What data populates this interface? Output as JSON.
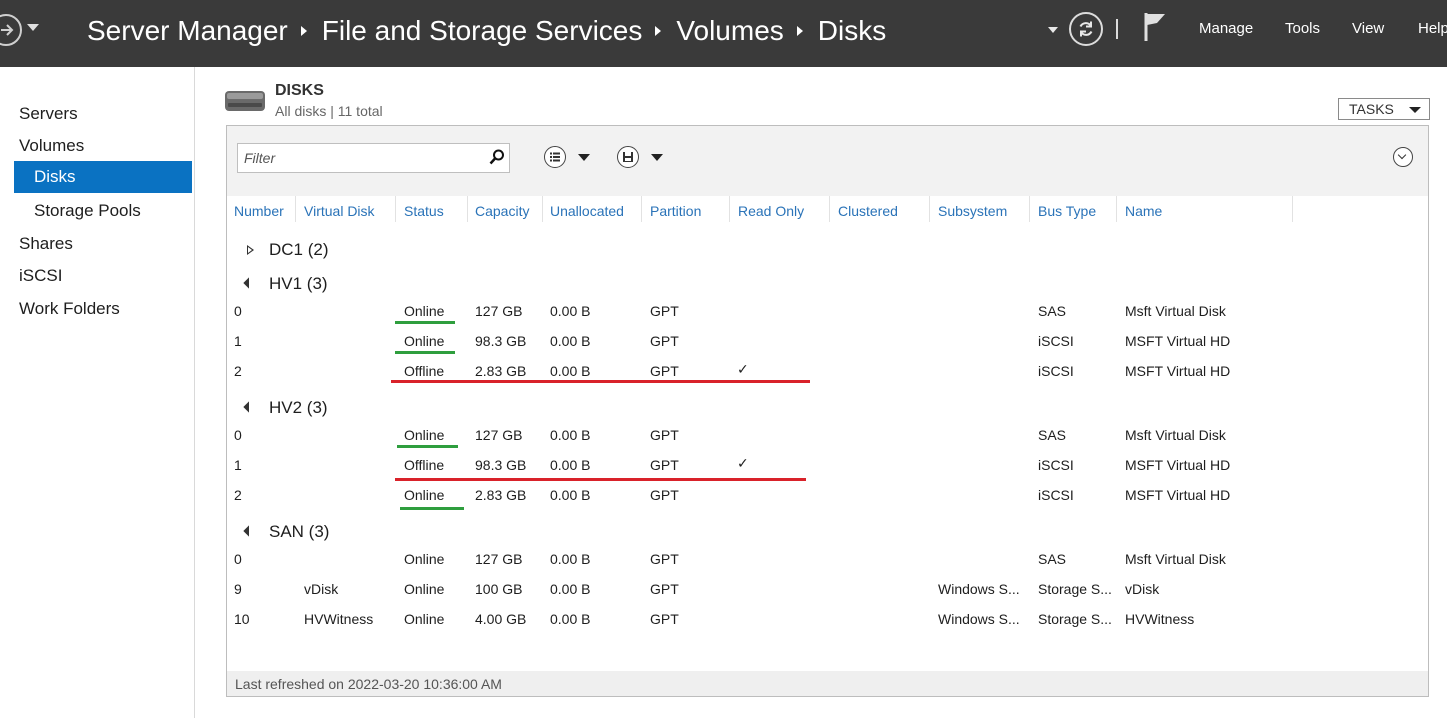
{
  "breadcrumb": [
    "Server Manager",
    "File and Storage Services",
    "Volumes",
    "Disks"
  ],
  "menu": {
    "manage": "Manage",
    "tools": "Tools",
    "view": "View",
    "help": "Help"
  },
  "sidebar": {
    "items": [
      {
        "label": "Servers"
      },
      {
        "label": "Volumes"
      },
      {
        "label": "Disks"
      },
      {
        "label": "Storage Pools"
      },
      {
        "label": "Shares"
      },
      {
        "label": "iSCSI"
      },
      {
        "label": "Work Folders"
      }
    ]
  },
  "section": {
    "title": "DISKS",
    "subtitle": "All disks | 11 total",
    "tasks_label": "TASKS"
  },
  "filter": {
    "placeholder": "Filter"
  },
  "columns": [
    "Number",
    "Virtual Disk",
    "Status",
    "Capacity",
    "Unallocated",
    "Partition",
    "Read Only",
    "Clustered",
    "Subsystem",
    "Bus Type",
    "Name"
  ],
  "groups": [
    {
      "label": "DC1 (2)",
      "expanded": false,
      "rows": []
    },
    {
      "label": "HV1 (3)",
      "expanded": true,
      "rows": [
        {
          "number": "0",
          "virtual_disk": "",
          "status": "Online",
          "capacity": "127 GB",
          "unallocated": "0.00 B",
          "partition": "GPT",
          "read_only": "",
          "clustered": "",
          "subsystem": "",
          "bus_type": "SAS",
          "name": "Msft Virtual Disk"
        },
        {
          "number": "1",
          "virtual_disk": "",
          "status": "Online",
          "capacity": "98.3 GB",
          "unallocated": "0.00 B",
          "partition": "GPT",
          "read_only": "",
          "clustered": "",
          "subsystem": "",
          "bus_type": "iSCSI",
          "name": "MSFT Virtual HD"
        },
        {
          "number": "2",
          "virtual_disk": "",
          "status": "Offline",
          "capacity": "2.83 GB",
          "unallocated": "0.00 B",
          "partition": "GPT",
          "read_only": "✓",
          "clustered": "",
          "subsystem": "",
          "bus_type": "iSCSI",
          "name": "MSFT Virtual HD"
        }
      ]
    },
    {
      "label": "HV2 (3)",
      "expanded": true,
      "rows": [
        {
          "number": "0",
          "virtual_disk": "",
          "status": "Online",
          "capacity": "127 GB",
          "unallocated": "0.00 B",
          "partition": "GPT",
          "read_only": "",
          "clustered": "",
          "subsystem": "",
          "bus_type": "SAS",
          "name": "Msft Virtual Disk"
        },
        {
          "number": "1",
          "virtual_disk": "",
          "status": "Offline",
          "capacity": "98.3 GB",
          "unallocated": "0.00 B",
          "partition": "GPT",
          "read_only": "✓",
          "clustered": "",
          "subsystem": "",
          "bus_type": "iSCSI",
          "name": "MSFT Virtual HD"
        },
        {
          "number": "2",
          "virtual_disk": "",
          "status": "Online",
          "capacity": "2.83 GB",
          "unallocated": "0.00 B",
          "partition": "GPT",
          "read_only": "",
          "clustered": "",
          "subsystem": "",
          "bus_type": "iSCSI",
          "name": "MSFT Virtual HD"
        }
      ]
    },
    {
      "label": "SAN (3)",
      "expanded": true,
      "rows": [
        {
          "number": "0",
          "virtual_disk": "",
          "status": "Online",
          "capacity": "127 GB",
          "unallocated": "0.00 B",
          "partition": "GPT",
          "read_only": "",
          "clustered": "",
          "subsystem": "",
          "bus_type": "SAS",
          "name": "Msft Virtual Disk"
        },
        {
          "number": "9",
          "virtual_disk": "vDisk",
          "status": "Online",
          "capacity": "100 GB",
          "unallocated": "0.00 B",
          "partition": "GPT",
          "read_only": "",
          "clustered": "",
          "subsystem": "Windows S...",
          "bus_type": "Storage S...",
          "name": "vDisk"
        },
        {
          "number": "10",
          "virtual_disk": "HVWitness",
          "status": "Online",
          "capacity": "4.00 GB",
          "unallocated": "0.00 B",
          "partition": "GPT",
          "read_only": "",
          "clustered": "",
          "subsystem": "Windows S...",
          "bus_type": "Storage S...",
          "name": "HVWitness"
        }
      ]
    }
  ],
  "footer": {
    "last_refreshed": "Last refreshed on 2022-03-20 10:36:00 AM"
  },
  "colors": {
    "titlebar": "#3a3a3a",
    "accent": "#0a72c2",
    "column_header": "#2a73b8",
    "online_marker": "#2e9e3e",
    "offline_marker": "#d9222a"
  }
}
